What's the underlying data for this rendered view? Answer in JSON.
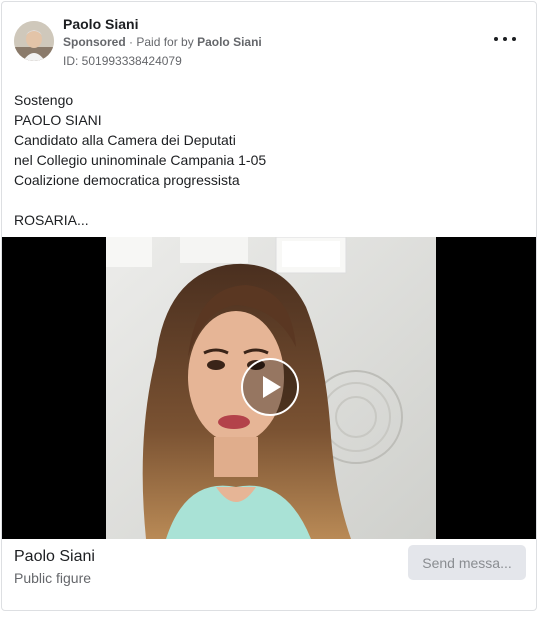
{
  "header": {
    "page_name": "Paolo Siani",
    "sponsored": "Sponsored",
    "paid_for_prefix": "Paid for by",
    "paid_for_name": "Paolo Siani",
    "ad_id": "ID: 501993338424079"
  },
  "post": {
    "lines": [
      "Sostengo",
      "PAOLO SIANI",
      "Candidato alla Camera dei Deputati",
      "nel Collegio uninominale Campania 1-05",
      "Coalizione democratica progressista",
      "",
      "ROSARIA..."
    ]
  },
  "footer": {
    "name": "Paolo Siani",
    "category": "Public figure",
    "cta_label": "Send messa..."
  },
  "icons": {
    "menu": "more-horizontal-icon",
    "play": "play-icon"
  },
  "colors": {
    "text": "#1c1e21",
    "secondary": "#65676b",
    "cta_bg": "#e4e6eb"
  }
}
